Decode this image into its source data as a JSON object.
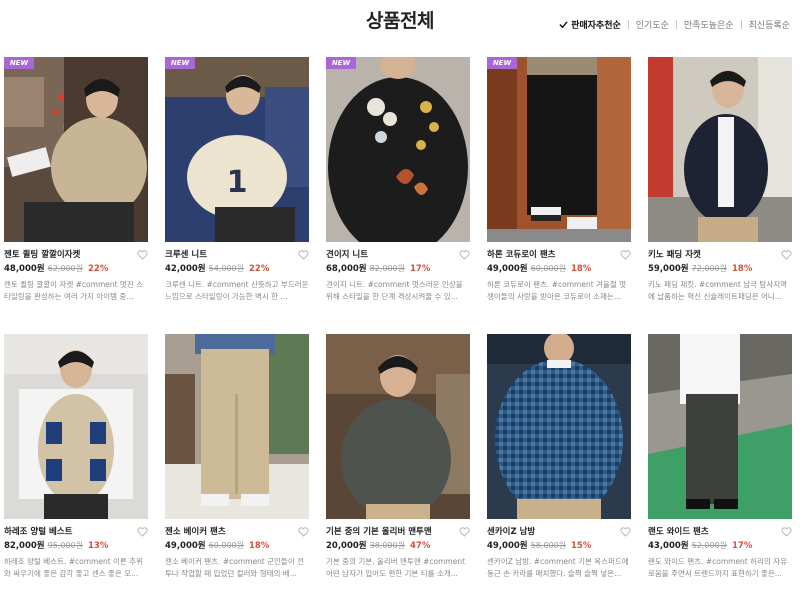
{
  "page": {
    "title": "상품전체"
  },
  "sort": {
    "options": [
      {
        "label": "판매자추천순",
        "active": true
      },
      {
        "label": "인기도순",
        "active": false
      },
      {
        "label": "만족도높은순",
        "active": false
      },
      {
        "label": "최신등록순",
        "active": false
      }
    ]
  },
  "colors": {
    "accent_badge": "#a866d6",
    "discount": "#d0533c"
  },
  "products": [
    {
      "badge": "NEW",
      "name": "젠토 퀼팅 깔깔이자켓",
      "price": "48,000원",
      "original": "62,000원",
      "discount": "22%",
      "description": "젠토 퀼팅 깔깔이 자켓 #comment 멋진 스타일링을 완성하는 여러 가지 아이템 중..."
    },
    {
      "badge": "NEW",
      "name": "크루센 니트",
      "price": "42,000원",
      "original": "54,000원",
      "discount": "22%",
      "description": "크루센 니트. #comment 산뜻하고 부드러운 느낌으로 스타일링이 가능한 벽시 한 ..."
    },
    {
      "badge": "NEW",
      "name": "견이지 니트",
      "price": "68,000원",
      "original": "82,000원",
      "discount": "17%",
      "description": "견이지 니트. #comment 멋스러운 인상을 위해 스타일을 한 단계 격상시켜줄 수 있..."
    },
    {
      "badge": "NEW",
      "name": "하론 코듀로이 팬츠",
      "price": "49,000원",
      "original": "60,000원",
      "discount": "18%",
      "description": "하론 코듀로이 팬츠. #comment 겨울철 멋쟁이들의 사랑을 받아온 코듀로이 소재는..."
    },
    {
      "badge": "",
      "name": "키노 패딩 자켓",
      "price": "59,000원",
      "original": "72,000원",
      "discount": "18%",
      "description": "키노 패딩 재킷. #comment 남극 탐사지역에 납품하는 혁신 신슐레이트패딩은 어니..."
    },
    {
      "badge": "",
      "name": "하레조 양털 베스트",
      "price": "82,000원",
      "original": "95,000원",
      "discount": "13%",
      "description": "하레조 양털 베스트. #comment 이른 추위와 싸우기에 좋은 감각 좋고 센스 좋은 오..."
    },
    {
      "badge": "",
      "name": "젠소 베이커 팬츠",
      "price": "49,000원",
      "original": "60,000원",
      "discount": "18%",
      "description": "젠소 베이커 팬츠. #comment 군인들이 전투나 작업할 때 입었던 컬러와 형태의 베..."
    },
    {
      "badge": "",
      "name": "기본 중의 기본 올리버 맨투맨",
      "price": "20,000원",
      "original": "38,000원",
      "discount": "47%",
      "description": "기본 중의 기본, 올리버 맨투맨 #comment 어떤 남자가 입어도 편한 기본 티를 소개..."
    },
    {
      "badge": "",
      "name": "센카이Z 남방",
      "price": "49,000원",
      "original": "58,000원",
      "discount": "15%",
      "description": "센카이Z 남방. #comment 기본 옥스퍼드에 동근 손 카라를 매치했다. 슬쩍 슬쩍 넣은..."
    },
    {
      "badge": "",
      "name": "랜도 와이드 팬츠",
      "price": "43,000원",
      "original": "52,000원",
      "discount": "17%",
      "description": "랜도 와이드 팬츠. #comment 허리의 자유로움을 주면서 트렌드까지 표현하기 좋은..."
    }
  ]
}
